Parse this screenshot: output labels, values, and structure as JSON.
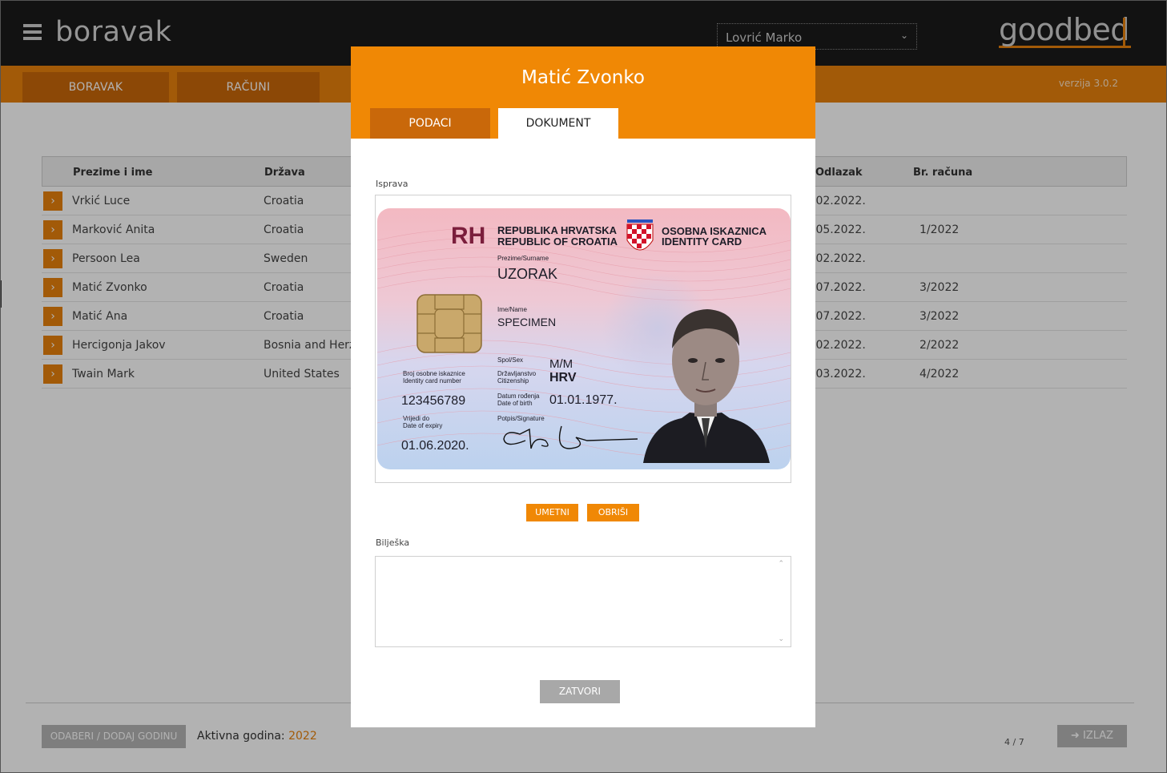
{
  "app": {
    "title": "boravak",
    "logo": "goodbed",
    "version": "verzija 3.0.2",
    "user": "Lovrić Marko"
  },
  "nav": {
    "tabs": [
      "BORAVAK",
      "RAČUNI"
    ]
  },
  "table": {
    "columns": [
      "Prezime i ime",
      "Država",
      "Odlazak",
      "Br. računa"
    ],
    "rows": [
      {
        "name": "Vrkić Luce",
        "country": "Croatia",
        "departure": ".02.2022.",
        "invoice": ""
      },
      {
        "name": "Marković Anita",
        "country": "Croatia",
        "departure": ".05.2022.",
        "invoice": "1/2022"
      },
      {
        "name": "Persoon Lea",
        "country": "Sweden",
        "departure": ".02.2022.",
        "invoice": ""
      },
      {
        "name": "Matić Zvonko",
        "country": "Croatia",
        "departure": ".07.2022.",
        "invoice": "3/2022"
      },
      {
        "name": "Matić Ana",
        "country": "Croatia",
        "departure": ".07.2022.",
        "invoice": "3/2022"
      },
      {
        "name": "Hercigonja Jakov",
        "country": "Bosnia and Herze",
        "departure": ".02.2022.",
        "invoice": "2/2022"
      },
      {
        "name": "Twain Mark",
        "country": "United States",
        "departure": ".03.2022.",
        "invoice": "4/2022"
      }
    ]
  },
  "footer": {
    "year_button": "ODABERI / DODAJ GODINU",
    "active_label": "Aktivna godina:",
    "active_year": "2022",
    "pager": "4 / 7",
    "exit": "IZLAZ"
  },
  "modal": {
    "title": "Matić Zvonko",
    "tabs": [
      "PODACI",
      "DOKUMENT"
    ],
    "active_tab": "DOKUMENT",
    "document_label": "Isprava",
    "insert_button": "UMETNI",
    "delete_button": "OBRIŠI",
    "note_label": "Bilješka",
    "note_value": "",
    "close_button": "ZATVORI"
  },
  "id_card": {
    "rh": "RH",
    "country_hr": "REPUBLIKA HRVATSKA",
    "country_en": "REPUBLIC OF CROATIA",
    "doc_hr": "OSOBNA ISKAZNICA",
    "doc_en": "IDENTITY CARD",
    "surname_label": "Prezime/Surname",
    "surname": "UZORAK",
    "name_label": "Ime/Name",
    "name": "SPECIMEN",
    "sex_label": "Spol/Sex",
    "sex": "M/M",
    "citizenship_label_hr": "Državljanstvo",
    "citizenship_label_en": "Citizenship",
    "citizenship": "HRV",
    "number_label_hr": "Broj osobne iskaznice",
    "number_label_en": "Identity card number",
    "number": "123456789",
    "dob_label_hr": "Datum rođenja",
    "dob_label_en": "Date of birth",
    "dob": "01.01.1977.",
    "expiry_label_hr": "Vrijedi do",
    "expiry_label_en": "Date of expiry",
    "expiry": "01.06.2020.",
    "signature_label": "Potpis/Signature"
  }
}
